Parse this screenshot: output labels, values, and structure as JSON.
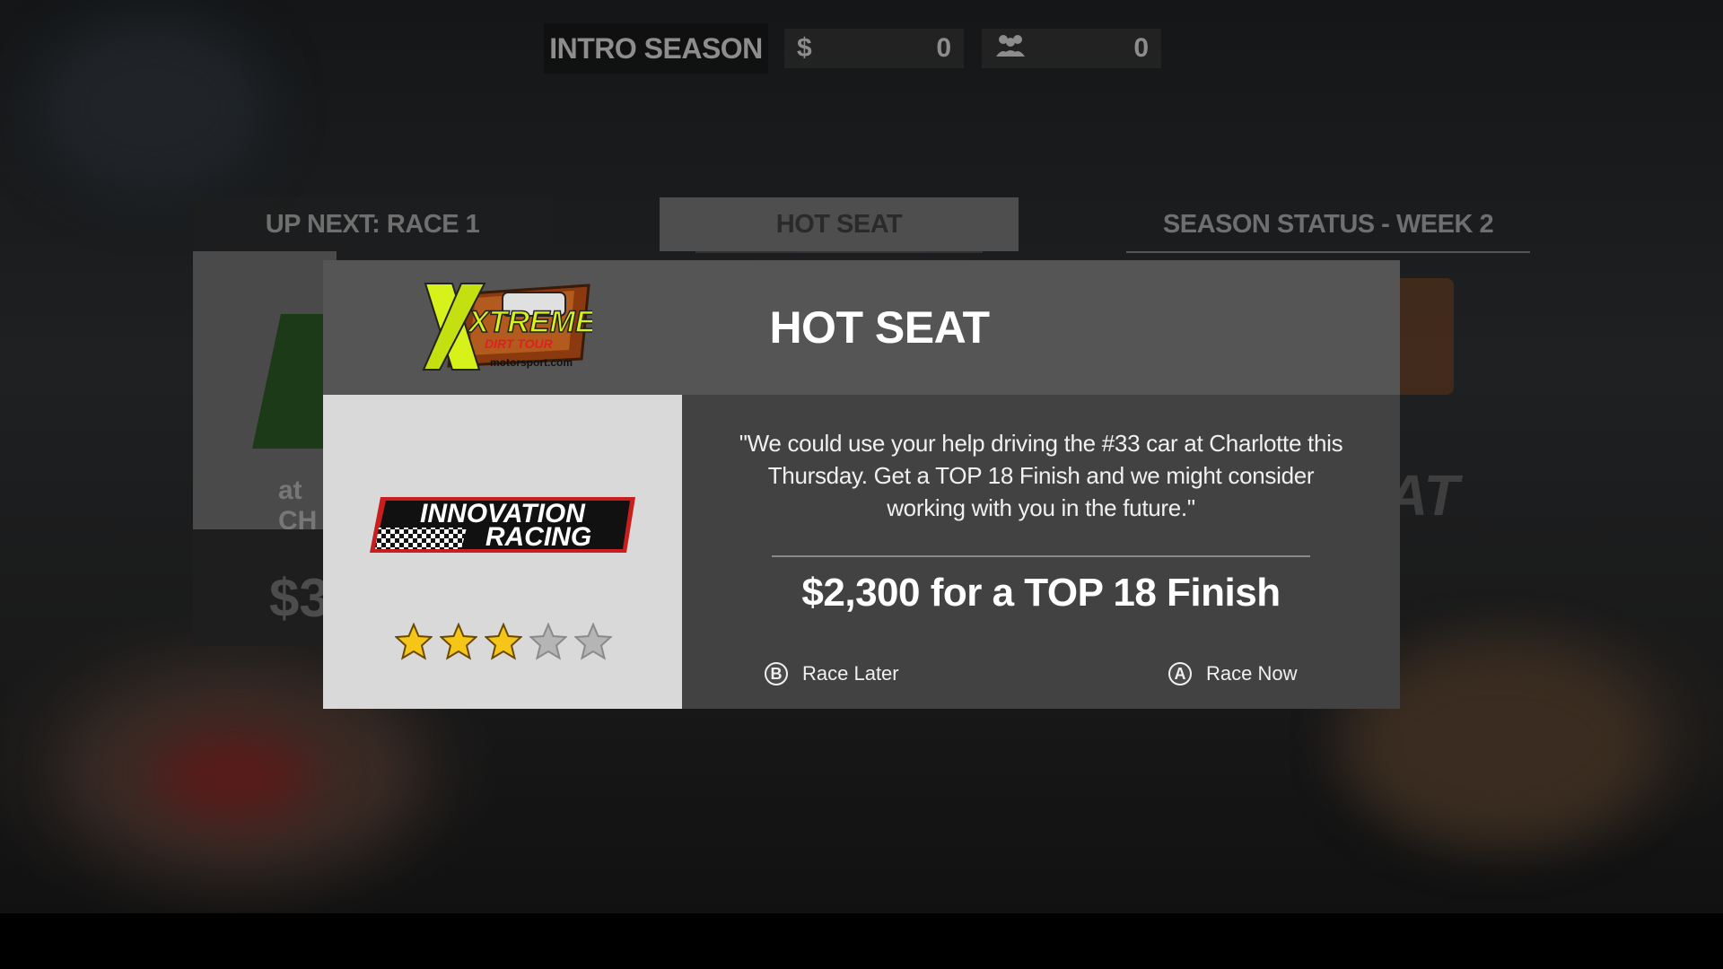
{
  "hud": {
    "season_label": "INTRO SEASON",
    "money_icon": "dollar-icon",
    "money_symbol": "$",
    "money_value": "0",
    "fans_icon": "fans-icon",
    "fans_value": "0"
  },
  "tabs": [
    {
      "label": "UP NEXT: RACE 1"
    },
    {
      "label": "HOT SEAT"
    },
    {
      "label": "SEASON STATUS - WEEK 2"
    }
  ],
  "background": {
    "left_card_text": "at CH",
    "left_card_amount": "$3",
    "right_card_text": "AT"
  },
  "modal": {
    "title": "HOT SEAT",
    "series_logo": {
      "line1": "XTREME",
      "line2": "DIRT TOUR",
      "line3": "motorsport.com"
    },
    "team_logo": {
      "line1": "INNOVATION",
      "line2": "RACING"
    },
    "rating": {
      "value": 3,
      "max": 5
    },
    "quote": "\"We could use your help driving the #33 car at Charlotte this Thursday. Get a TOP 18 Finish and we might consider working with you in the future.\"",
    "reward": "$2,300 for a TOP 18 Finish",
    "actions": [
      {
        "glyph": "B",
        "label": "Race Later"
      },
      {
        "glyph": "A",
        "label": "Race Now"
      }
    ]
  },
  "colors": {
    "modal_header": "#555555",
    "team_panel": "#d9d9d9",
    "info_panel": "#424242",
    "star_filled": "#f5c518",
    "star_empty": "#b5b5b5"
  }
}
